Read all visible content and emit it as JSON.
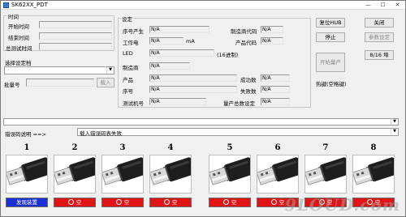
{
  "window": {
    "title": "SK62XX_PDT",
    "minimize": "—",
    "maximize": "☐",
    "close": "✕"
  },
  "time_group": {
    "label": "时间",
    "fields": [
      {
        "label": "开始时间",
        "value": ""
      },
      {
        "label": "结束时间",
        "value": ""
      },
      {
        "label": "总测试时间",
        "value": ""
      }
    ]
  },
  "select_device": {
    "label": "选择设定档",
    "value": ""
  },
  "batch": {
    "label": "批量号",
    "value": "",
    "button": "载入"
  },
  "settings": {
    "label": "设定",
    "serial_prefix": {
      "label": "序号产生",
      "value": "N/A"
    },
    "vendor_code": {
      "label": "制造商代码",
      "value": "N/A"
    },
    "working_current": {
      "label": "工作电",
      "value": "N/A",
      "unit": "mA"
    },
    "product_code": {
      "label": "产品代码",
      "value": "N/A"
    },
    "led": {
      "label": "LED",
      "value": "N/A",
      "note": "(16进制)"
    },
    "manufacturer": {
      "label": "制造商",
      "value": "N/A"
    },
    "product": {
      "label": "产品",
      "value": "N/A"
    },
    "success_count": {
      "label": "成功数",
      "value": "N/A"
    },
    "serial": {
      "label": "序号",
      "value": "N/A"
    },
    "fail_count": {
      "label": "失败数",
      "value": "N/A"
    },
    "test_machine": {
      "label": "测试机号",
      "value": "N/A"
    },
    "total_setting": {
      "label": "量产总数设定",
      "value": "N/A"
    }
  },
  "buttons": {
    "reset_hub": "复位HUB",
    "close": "关闭",
    "stop": "停止",
    "param_settings": "参数设定",
    "start_production": "开始量产",
    "slots_toggle": "8/16 埠",
    "hotkey": "热键(空格键)"
  },
  "message_combo": {
    "value": ""
  },
  "error_desc": {
    "label": "错误码说明 ==>",
    "value": "载入错误码表失败"
  },
  "slots": [
    {
      "number": "1",
      "status": "发现装置",
      "status_color": "#1a2fd6"
    },
    {
      "number": "2",
      "status": "空",
      "status_color": "#e01414"
    },
    {
      "number": "3",
      "status": "空",
      "status_color": "#e01414"
    },
    {
      "number": "4",
      "status": "空",
      "status_color": "#e01414"
    },
    {
      "number": "5",
      "status": "空",
      "status_color": "#e01414"
    },
    {
      "number": "6",
      "status": "空",
      "status_color": "#e01414"
    },
    {
      "number": "7",
      "status": "空",
      "status_color": "#e01414"
    },
    {
      "number": "8",
      "status": "空",
      "status_color": "#e01414"
    }
  ],
  "watermark": "9LOUD.com"
}
